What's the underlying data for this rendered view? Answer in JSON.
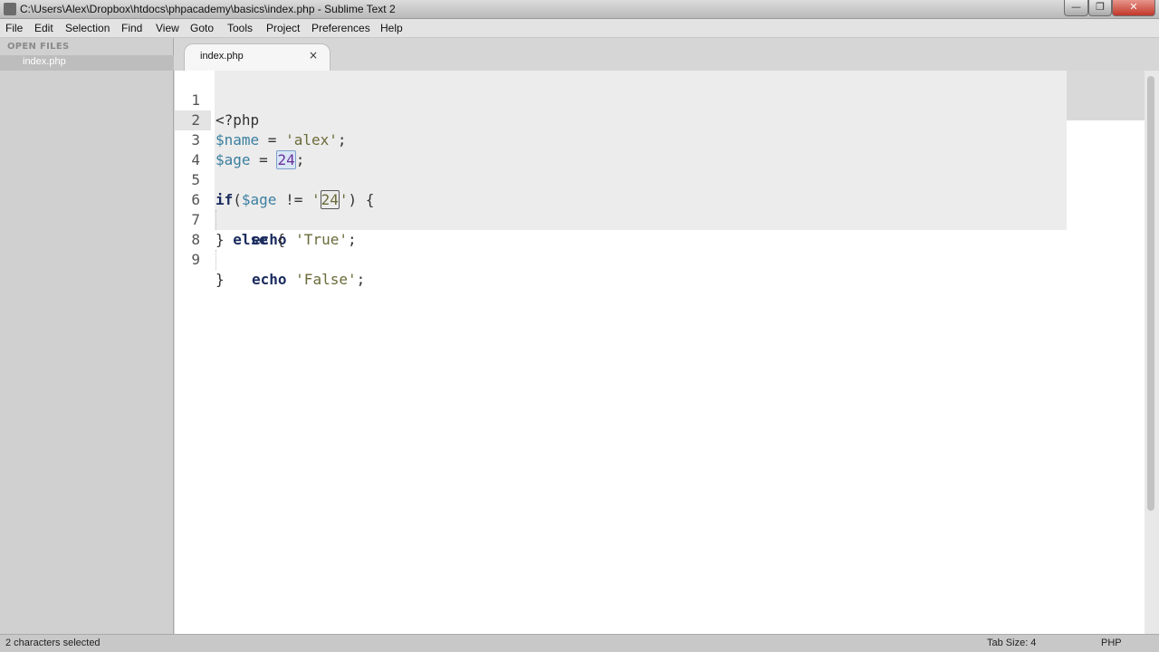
{
  "window": {
    "title": "C:\\Users\\Alex\\Dropbox\\htdocs\\phpacademy\\basics\\index.php - Sublime Text 2",
    "minimize": "—",
    "maximize": "❐",
    "close": "✕"
  },
  "menu": [
    "File",
    "Edit",
    "Selection",
    "Find",
    "View",
    "Goto",
    "Tools",
    "Project",
    "Preferences",
    "Help"
  ],
  "sidebar": {
    "header": "OPEN FILES",
    "files": [
      "index.php"
    ]
  },
  "tabs": [
    {
      "label": "index.php",
      "close": "×"
    }
  ],
  "editor": {
    "line_numbers": [
      "1",
      "2",
      "3",
      "4",
      "5",
      "6",
      "7",
      "8",
      "9"
    ],
    "current_line": 3,
    "tokens": {
      "l1": "<?php",
      "l2_var": "$name",
      "l2_op": " = ",
      "l2_str": "'alex'",
      "l2_end": ";",
      "l3_var": "$age",
      "l3_op": " = ",
      "l3_num": "24",
      "l3_end": ";",
      "l5_kw": "if",
      "l5_paren": "(",
      "l5_var": "$age",
      "l5_op": " != ",
      "l5_q1": "'",
      "l5_num": "24",
      "l5_q2": "'",
      "l5_end": ") {",
      "l6_kw": "echo",
      "l6_str": "'True'",
      "l6_end": ";",
      "l7_a": "} ",
      "l7_kw": "else",
      "l7_b": " {",
      "l8_kw": "echo",
      "l8_str": "'False'",
      "l8_end": ";",
      "l9": "}"
    }
  },
  "status": {
    "selection": "2 characters selected",
    "tab_size": "Tab Size: 4",
    "syntax": "PHP"
  }
}
